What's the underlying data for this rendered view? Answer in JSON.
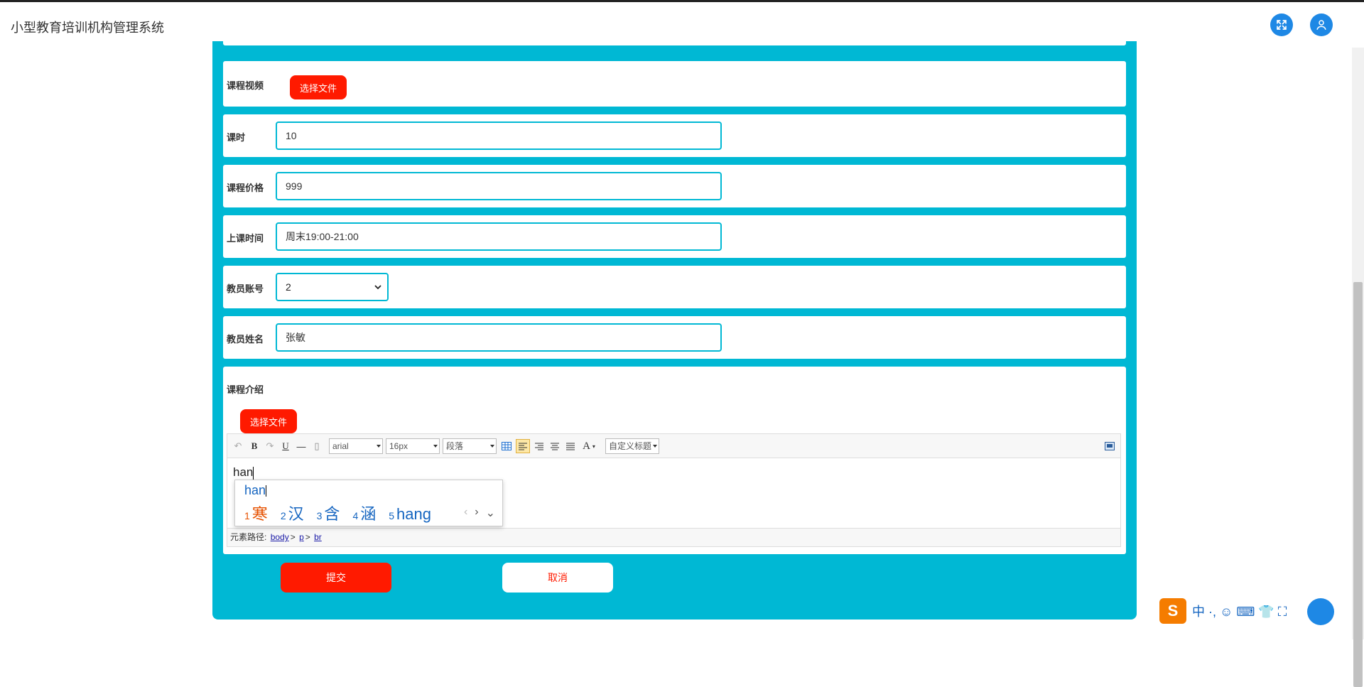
{
  "header": {
    "app_title": "小型教育培训机构管理系统",
    "fullscreen_icon": "expand-icon",
    "user_icon": "user-icon",
    "accent": "#1e88e5"
  },
  "form": {
    "video": {
      "label": "课程视频",
      "button": "选择文件"
    },
    "hours": {
      "label": "课时",
      "value": "10"
    },
    "price": {
      "label": "课程价格",
      "value": "999"
    },
    "schedule": {
      "label": "上课时间",
      "value": "周末19:00-21:00"
    },
    "teacher_account": {
      "label": "教员账号",
      "value": "2"
    },
    "teacher_name": {
      "label": "教员姓名",
      "value": "张敏"
    },
    "intro": {
      "label": "课程介绍",
      "button": "选择文件"
    }
  },
  "editor": {
    "toolbar": {
      "bold": "B",
      "underline": "U",
      "font_family": "arial",
      "font_size": "16px",
      "paragraph": "段落",
      "font_color": "A",
      "custom_heading": "自定义标题"
    },
    "content": "han",
    "path_label": "元素路径:",
    "path": [
      "body",
      "p",
      "br"
    ]
  },
  "ime": {
    "pinyin": "han",
    "candidates": [
      {
        "n": "1",
        "text": "寒"
      },
      {
        "n": "2",
        "text": "汉"
      },
      {
        "n": "3",
        "text": "含"
      },
      {
        "n": "4",
        "text": "涵"
      },
      {
        "n": "5",
        "text": "hang"
      }
    ]
  },
  "actions": {
    "submit": "提交",
    "cancel": "取消"
  },
  "watermark": {
    "text": "中 ·, ☺ ⌨ 👕 ⛶",
    "brand": "S"
  },
  "colors": {
    "panel": "#00b8d4",
    "primary_btn": "#ff1a00"
  }
}
